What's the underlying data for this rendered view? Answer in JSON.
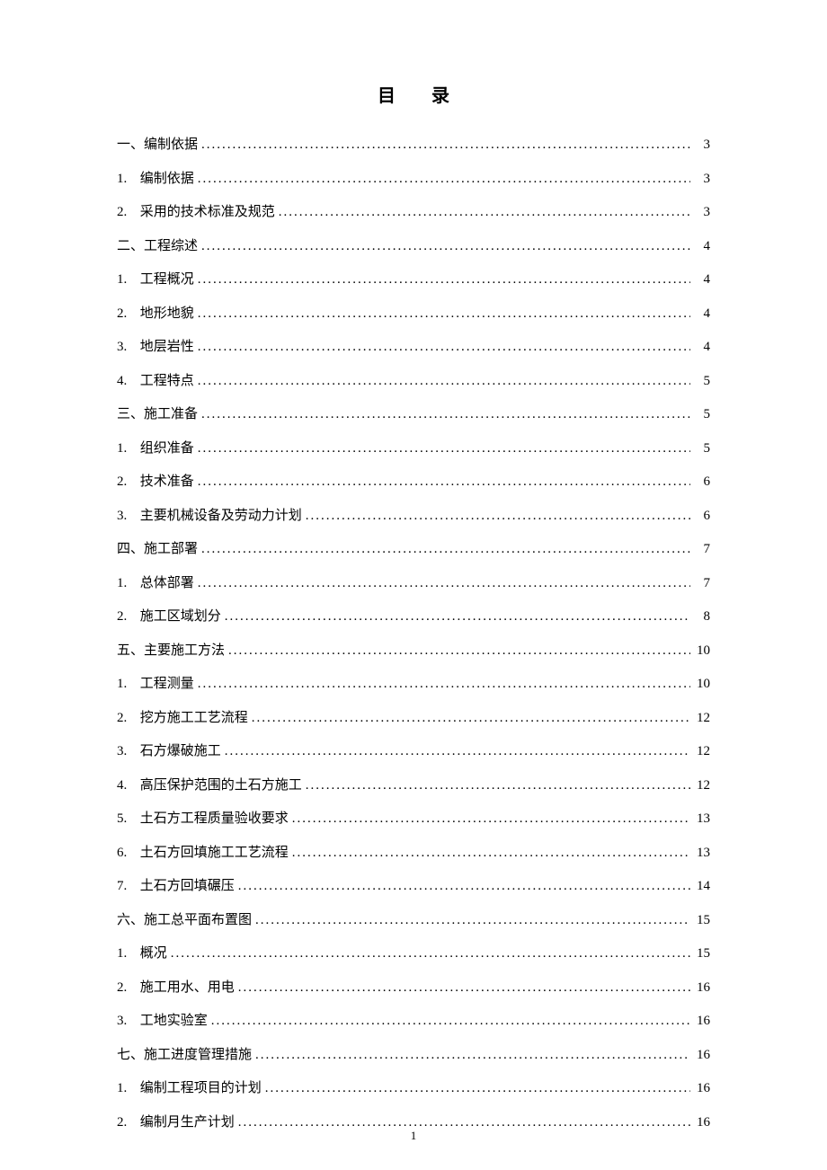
{
  "title": "目录",
  "page_number": "1",
  "entries": [
    {
      "level": 0,
      "num": "一、",
      "label": "编制依据",
      "page": "3"
    },
    {
      "level": 1,
      "num": "1.",
      "label": "编制依据",
      "page": "3"
    },
    {
      "level": 1,
      "num": "2.",
      "label": "采用的技术标准及规范",
      "page": "3"
    },
    {
      "level": 0,
      "num": "二、",
      "label": "工程综述",
      "page": "4"
    },
    {
      "level": 1,
      "num": "1.",
      "label": "工程概况",
      "page": "4"
    },
    {
      "level": 1,
      "num": "2.",
      "label": "地形地貌",
      "page": "4"
    },
    {
      "level": 1,
      "num": "3.",
      "label": "地层岩性",
      "page": "4"
    },
    {
      "level": 1,
      "num": "4.",
      "label": "工程特点",
      "page": "5"
    },
    {
      "level": 0,
      "num": "三、",
      "label": "施工准备",
      "page": "5"
    },
    {
      "level": 1,
      "num": "1.",
      "label": "组织准备",
      "page": "5"
    },
    {
      "level": 1,
      "num": "2.",
      "label": "技术准备",
      "page": "6"
    },
    {
      "level": 1,
      "num": "3.",
      "label": "主要机械设备及劳动力计划",
      "page": "6"
    },
    {
      "level": 0,
      "num": "四、",
      "label": "施工部署",
      "page": "7"
    },
    {
      "level": 1,
      "num": "1.",
      "label": "总体部署",
      "page": "7"
    },
    {
      "level": 1,
      "num": "2.",
      "label": "施工区域划分",
      "page": "8"
    },
    {
      "level": 0,
      "num": "五、",
      "label": "主要施工方法",
      "page": "10"
    },
    {
      "level": 1,
      "num": "1.",
      "label": "工程测量",
      "page": "10"
    },
    {
      "level": 1,
      "num": "2.",
      "label": "挖方施工工艺流程",
      "page": "12"
    },
    {
      "level": 1,
      "num": "3.",
      "label": "石方爆破施工",
      "page": "12"
    },
    {
      "level": 1,
      "num": "4.",
      "label": "高压保护范围的土石方施工",
      "page": "12"
    },
    {
      "level": 1,
      "num": "5.",
      "label": "土石方工程质量验收要求",
      "page": "13"
    },
    {
      "level": 1,
      "num": "6.",
      "label": "土石方回填施工工艺流程",
      "page": "13"
    },
    {
      "level": 1,
      "num": "7.",
      "label": "土石方回填碾压",
      "page": "14"
    },
    {
      "level": 0,
      "num": "六、",
      "label": "施工总平面布置图",
      "page": "15"
    },
    {
      "level": 1,
      "num": "1.",
      "label": "概况",
      "page": "15"
    },
    {
      "level": 1,
      "num": "2.",
      "label": "施工用水、用电",
      "page": "16"
    },
    {
      "level": 1,
      "num": "3.",
      "label": "工地实验室",
      "page": "16"
    },
    {
      "level": 0,
      "num": "七、",
      "label": "施工进度管理措施",
      "page": "16"
    },
    {
      "level": 1,
      "num": "1.",
      "label": "编制工程项目的计划",
      "page": "16"
    },
    {
      "level": 1,
      "num": "2.",
      "label": "编制月生产计划",
      "page": "16"
    }
  ]
}
